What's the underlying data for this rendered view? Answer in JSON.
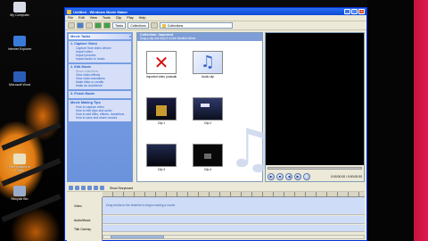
{
  "window": {
    "title": "Untitled - Windows Movie Maker",
    "menu": [
      "File",
      "Edit",
      "View",
      "Tools",
      "Clip",
      "Play",
      "Help"
    ],
    "tasks_button": "Tasks",
    "collections_button": "Collections",
    "collection_dropdown": "Collections"
  },
  "desktop_icons": [
    {
      "label": "My Computer"
    },
    {
      "label": "Internet Explorer"
    },
    {
      "label": "Microsoft Word"
    },
    {
      "label": "Free Images of Christ"
    },
    {
      "label": "Recycle Bin"
    }
  ],
  "task_pane": {
    "header": "Movie Tasks",
    "sections": [
      {
        "title": "1. Capture Video",
        "links": [
          "Capture from video device",
          "Import video",
          "Import pictures",
          "Import audio or music"
        ]
      },
      {
        "title": "2. Edit Movie",
        "links": [
          "Show collections",
          "View video effects",
          "View video transitions",
          "Make titles or credits",
          "Make an AutoMovie"
        ]
      },
      {
        "title": "3. Finish Movie",
        "links": []
      },
      {
        "title": "Movie Making Tips",
        "links": [
          "How to capture video",
          "How to edit clips and audio",
          "How to add titles, effects, transitions",
          "How to save and share movies"
        ]
      }
    ]
  },
  "collection": {
    "title": "Collection: Imported",
    "subtitle": "Drag a clip and drop it on the timeline below.",
    "items": [
      {
        "caption": "Imported video (unavailable)",
        "kind": "error"
      },
      {
        "caption": "Audio clip",
        "kind": "audio"
      },
      {
        "caption": "Clip 1",
        "kind": "video"
      },
      {
        "caption": "Clip 2",
        "kind": "video"
      },
      {
        "caption": "Clip 3",
        "kind": "video"
      },
      {
        "caption": "Clip 4",
        "kind": "video"
      }
    ]
  },
  "preview": {
    "time": "0:00:00.00 / 0:00:00.00"
  },
  "timeline": {
    "show_storyboard": "Show Storyboard",
    "tracks": [
      {
        "label": "Video",
        "hint": "Drag media to the timeline to begin making a movie."
      },
      {
        "label": "Audio/Music",
        "hint": ""
      },
      {
        "label": "Title Overlay",
        "hint": ""
      }
    ]
  }
}
